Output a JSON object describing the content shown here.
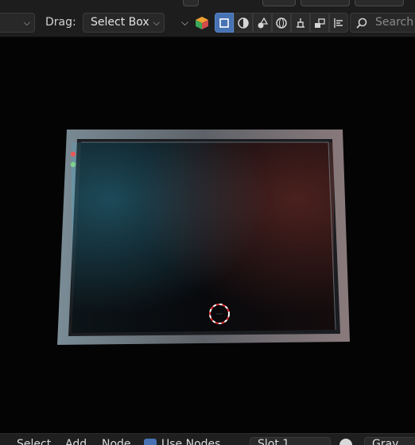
{
  "header": {
    "drag_label": "Drag:",
    "drag_value": "Select Box",
    "search_placeholder": "Search"
  },
  "viewport": {
    "description_colors": {
      "frame": "#6e7882",
      "screen": "#0a0b10",
      "accent_cyan": "#3fb4d8",
      "accent_red": "#e0584a"
    }
  },
  "bottom_bar": {
    "menu": [
      "Select",
      "Add",
      "Node"
    ],
    "use_nodes_label": "Use Nodes",
    "slot_value": "Slot 1",
    "partial_label": "Gray Pla"
  },
  "colors": {
    "accent": "#4772b3",
    "header_bg": "#1d1d1d"
  }
}
